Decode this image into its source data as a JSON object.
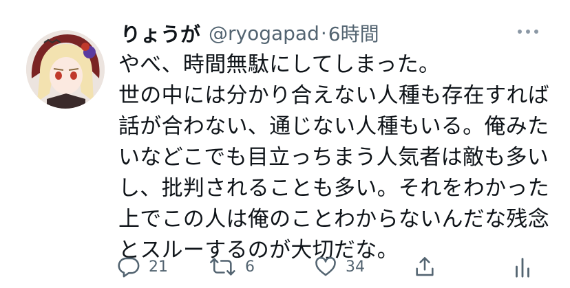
{
  "tweet": {
    "display_name": "りょうが",
    "handle": "@ryogapad",
    "separator": "·",
    "time": "6時間",
    "lines": [
      "やべ、時間無駄にしてしまった。",
      "世の中には分かり合えない人種も存在すれば",
      "話が合わない、通じない人種もいる。俺みた",
      "いなどこでも目立っちまう人気者は敵も多い",
      "し、批判されることも多い。それをわかった",
      "上でこの人は俺のことわからないんだな残念",
      "とスルーするのが大切だな。"
    ]
  },
  "actions": {
    "reply_count": "21",
    "retweet_count": "6",
    "like_count": "34"
  },
  "icons": {
    "reply": "reply-icon",
    "retweet": "retweet-icon",
    "like": "heart-icon",
    "share": "share-icon",
    "analytics": "analytics-icon",
    "more": "more-icon"
  },
  "colors": {
    "text_primary": "#0f1419",
    "text_secondary": "#536471",
    "background": "#ffffff"
  }
}
